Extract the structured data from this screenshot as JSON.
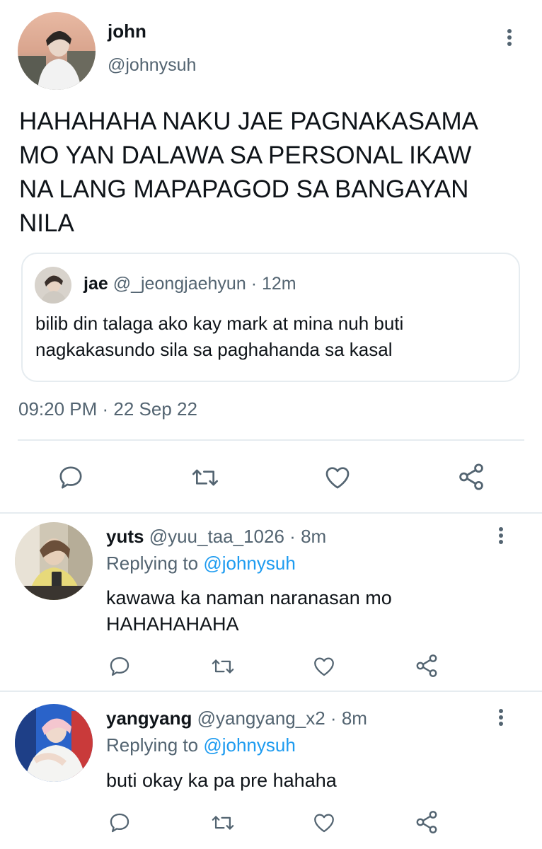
{
  "main_tweet": {
    "author_name": "john",
    "author_handle": "@johnysuh",
    "text_lines": [
      "HAHAHAHA NAKU JAE PAGNAKASAMA",
      "MO YAN DALAWA SA PERSONAL IKAW",
      "NA LANG MAPAPAGOD SA BANGAYAN",
      "NILA"
    ],
    "quoted": {
      "author_name": "jae",
      "author_handle": "@_jeongjaehyun",
      "separator": "·",
      "time": "12m",
      "text_lines": [
        "bilib din talaga ako kay mark at mina nuh buti",
        "nagkakasundo sila sa paghahanda sa kasal"
      ]
    },
    "timestamp": "09:20 PM · 22 Sep 22",
    "actions": [
      "reply-icon",
      "retweet-icon",
      "like-icon",
      "share-icon"
    ]
  },
  "replies": [
    {
      "author_name": "yuts",
      "author_handle": "@yuu_taa_1026",
      "separator": "·",
      "time": "8m",
      "replying_prefix": "Replying to",
      "replying_to": "@johnysuh",
      "text_lines": [
        "kawawa ka naman naranasan mo",
        "HAHAHAHAHA"
      ]
    },
    {
      "author_name": "yangyang",
      "author_handle": "@yangyang_x2",
      "separator": "·",
      "time": "8m",
      "replying_prefix": "Replying to",
      "replying_to": "@johnysuh",
      "text_lines": [
        "buti okay ka pa pre hahaha"
      ]
    }
  ],
  "colors": {
    "accent": "#1d9bf0",
    "muted": "#536471",
    "text": "#0f1419",
    "divider": "#e6ecf0"
  }
}
